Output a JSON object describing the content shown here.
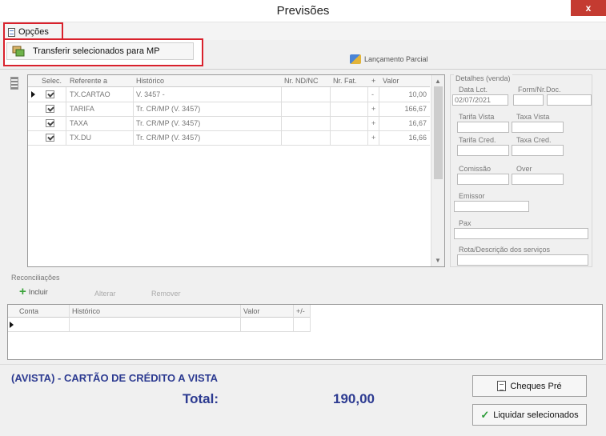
{
  "window": {
    "title": "Previsões",
    "close": "x"
  },
  "menu": {
    "opcoes": "Opções"
  },
  "dropdown": {
    "transferir": "Transferir selecionados para MP"
  },
  "toolbar": {
    "lancamento_parcial": "Lançamento Parcial"
  },
  "grid": {
    "headers": [
      "Selec.",
      "Referente a",
      "Histórico",
      "Nr. ND/NC",
      "Nr. Fat.",
      "+",
      "Valor"
    ],
    "rows": [
      {
        "ref": "TX.CARTAO",
        "hist": "V. 3457 -",
        "sinal": "-",
        "valor": "10,00"
      },
      {
        "ref": "TARIFA",
        "hist": "Tr. CR/MP (V. 3457)",
        "sinal": "+",
        "valor": "166,67"
      },
      {
        "ref": "TAXA",
        "hist": "Tr. CR/MP (V. 3457)",
        "sinal": "+",
        "valor": "16,67"
      },
      {
        "ref": "TX.DU",
        "hist": "Tr. CR/MP (V. 3457)",
        "sinal": "+",
        "valor": "16,66"
      }
    ]
  },
  "detalhes": {
    "title": "Detalhes (venda)",
    "data_lct": "Data Lct.",
    "data_val": "02/07/2021",
    "form_nr_doc": "Form/Nr.Doc.",
    "tarifa_vista": "Tarifa Vista",
    "taxa_vista": "Taxa Vista",
    "tarifa_cred": "Tarifa Cred.",
    "taxa_cred": "Taxa Cred.",
    "comissao": "Comissão",
    "over": "Over",
    "emissor": "Emissor",
    "pax": "Pax",
    "rota": "Rota/Descrição dos serviços"
  },
  "reconciliacoes": {
    "title": "Reconciliações",
    "incluir": "Incluir",
    "alterar": "Alterar",
    "remover": "Remover",
    "headers": [
      "Conta",
      "Histórico",
      "Valor",
      "+/-"
    ]
  },
  "summary": {
    "avista": "(AVISTA) - CARTÃO DE CRÉDITO A VISTA",
    "total_label": "Total:",
    "total_value": "190,00"
  },
  "buttons": {
    "cheques": "Cheques Pré",
    "liquidar": "Liquidar selecionados"
  },
  "colors": {
    "accent_blue": "#2d3b91",
    "highlight_red": "#d9212c"
  }
}
